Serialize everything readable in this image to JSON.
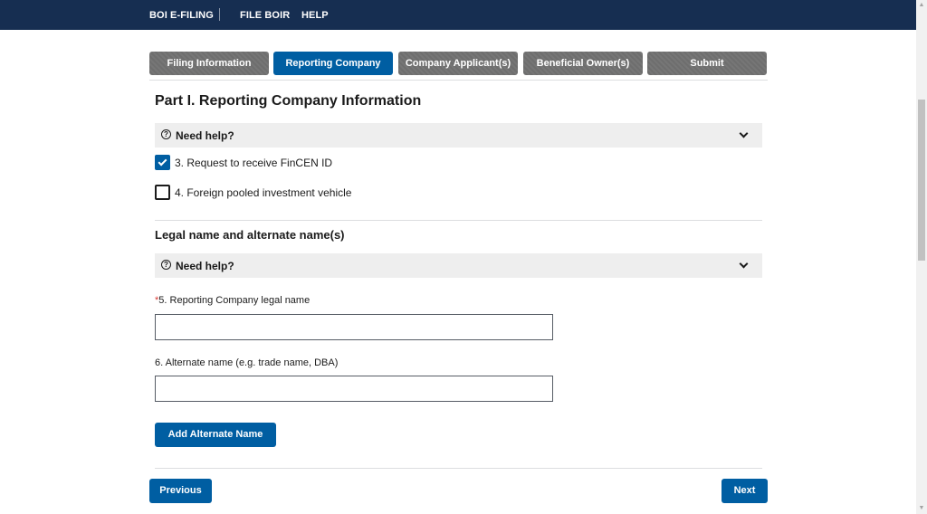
{
  "topnav": {
    "brand": "BOI E-FILING",
    "file_boir": "FILE BOIR",
    "help": "HELP"
  },
  "steps": [
    {
      "label": "Filing Information",
      "active": false
    },
    {
      "label": "Reporting Company",
      "active": true
    },
    {
      "label": "Company Applicant(s)",
      "active": false
    },
    {
      "label": "Beneficial Owner(s)",
      "active": false
    },
    {
      "label": "Submit",
      "active": false
    }
  ],
  "part": {
    "title": "Part I. Reporting Company Information",
    "help_label": "Need help?",
    "checkboxes": [
      {
        "label": "3. Request to receive FinCEN ID",
        "checked": true
      },
      {
        "label": "4. Foreign pooled investment vehicle",
        "checked": false
      }
    ]
  },
  "legal_name": {
    "title": "Legal name and alternate name(s)",
    "help_label": "Need help?",
    "required_marker": "*",
    "legal_name_label": "5. Reporting Company legal name",
    "legal_name_value": "",
    "alternate_name_label": "6. Alternate name (e.g. trade name, DBA)",
    "alternate_name_value": "",
    "add_alternate_button": "Add Alternate Name"
  },
  "footer": {
    "previous": "Previous",
    "next": "Next"
  },
  "colors": {
    "topbar": "#162e51",
    "primary": "#005ea2",
    "inactive_step": "#6e6e6e",
    "help_bar": "#eeeeee",
    "required": "#d83933"
  },
  "icons": [
    "question-circle-icon",
    "chevron-down-icon",
    "checkmark-icon",
    "scroll-up-arrow-icon",
    "scroll-down-arrow-icon"
  ]
}
